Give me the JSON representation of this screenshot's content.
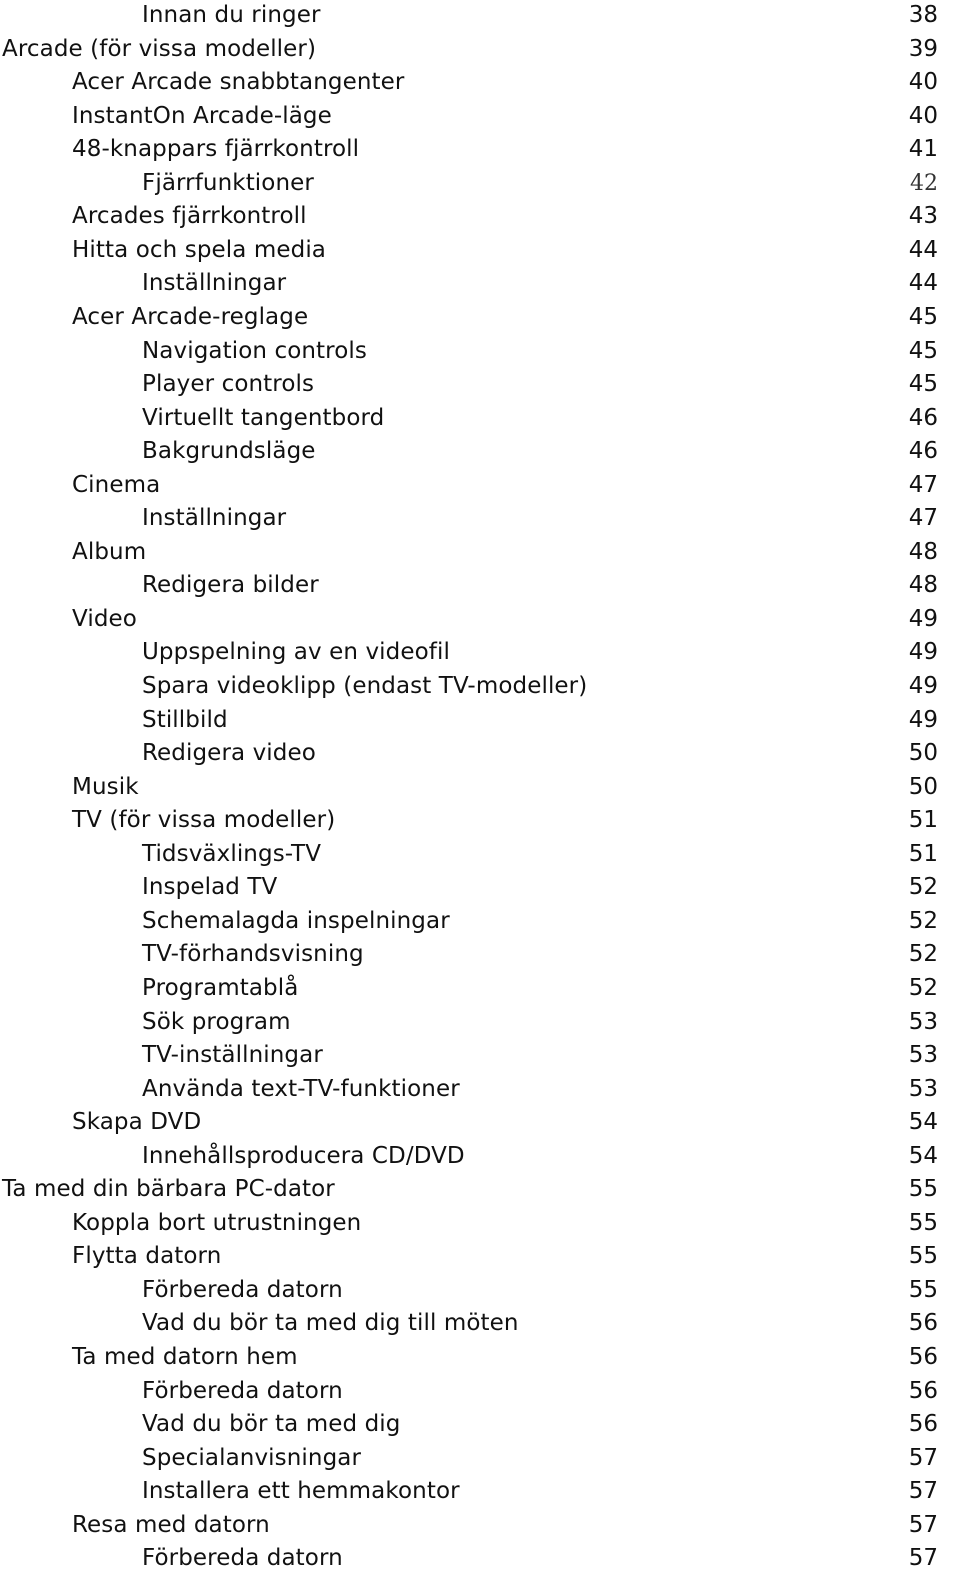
{
  "document": {
    "section": "table-of-contents",
    "entries": [
      {
        "title": "Innan du ringer",
        "page": "38",
        "level": 2
      },
      {
        "title": "Arcade (för vissa modeller)",
        "page": "39",
        "level": 0
      },
      {
        "title": "Acer Arcade snabbtangenter",
        "page": "40",
        "level": 1
      },
      {
        "title": "InstantOn Arcade-läge",
        "page": "40",
        "level": 1
      },
      {
        "title": "48-knappars fjärrkontroll",
        "page": "41",
        "level": 1
      },
      {
        "title": "Fjärrfunktioner",
        "page": "42",
        "level": 2,
        "page_style": "serif"
      },
      {
        "title": "Arcades fjärrkontroll",
        "page": "43",
        "level": 1
      },
      {
        "title": "Hitta och spela media",
        "page": "44",
        "level": 1
      },
      {
        "title": "Inställningar",
        "page": "44",
        "level": 2
      },
      {
        "title": "Acer Arcade-reglage",
        "page": "45",
        "level": 1
      },
      {
        "title": "Navigation controls",
        "page": "45",
        "level": 2
      },
      {
        "title": "Player controls",
        "page": "45",
        "level": 2
      },
      {
        "title": "Virtuellt tangentbord",
        "page": "46",
        "level": 2
      },
      {
        "title": "Bakgrundsläge",
        "page": "46",
        "level": 2
      },
      {
        "title": "Cinema",
        "page": "47",
        "level": 1
      },
      {
        "title": "Inställningar",
        "page": "47",
        "level": 2
      },
      {
        "title": "Album",
        "page": "48",
        "level": 1
      },
      {
        "title": "Redigera bilder",
        "page": "48",
        "level": 2
      },
      {
        "title": "Video",
        "page": "49",
        "level": 1
      },
      {
        "title": "Uppspelning av en videofil",
        "page": "49",
        "level": 2
      },
      {
        "title": "Spara videoklipp (endast TV-modeller)",
        "page": "49",
        "level": 2
      },
      {
        "title": "Stillbild",
        "page": "49",
        "level": 2
      },
      {
        "title": "Redigera video",
        "page": "50",
        "level": 2
      },
      {
        "title": "Musik",
        "page": "50",
        "level": 1
      },
      {
        "title": "TV (för vissa modeller)",
        "page": "51",
        "level": 1
      },
      {
        "title": "Tidsväxlings-TV",
        "page": "51",
        "level": 2
      },
      {
        "title": "Inspelad TV",
        "page": "52",
        "level": 2
      },
      {
        "title": "Schemalagda inspelningar",
        "page": "52",
        "level": 2
      },
      {
        "title": "TV-förhandsvisning",
        "page": "52",
        "level": 2
      },
      {
        "title": "Programtablå",
        "page": "52",
        "level": 2
      },
      {
        "title": "Sök program",
        "page": "53",
        "level": 2
      },
      {
        "title": "TV-inställningar",
        "page": "53",
        "level": 2
      },
      {
        "title": "Använda text-TV-funktioner",
        "page": "53",
        "level": 2
      },
      {
        "title": "Skapa DVD",
        "page": "54",
        "level": 1
      },
      {
        "title": "Innehållsproducera CD/DVD",
        "page": "54",
        "level": 2
      },
      {
        "title": "Ta med din bärbara PC-dator",
        "page": "55",
        "level": 0
      },
      {
        "title": "Koppla bort utrustningen",
        "page": "55",
        "level": 1
      },
      {
        "title": "Flytta datorn",
        "page": "55",
        "level": 1
      },
      {
        "title": "Förbereda datorn",
        "page": "55",
        "level": 2
      },
      {
        "title": "Vad du bör ta med dig till möten",
        "page": "56",
        "level": 2
      },
      {
        "title": "Ta med datorn hem",
        "page": "56",
        "level": 1
      },
      {
        "title": "Förbereda datorn",
        "page": "56",
        "level": 2
      },
      {
        "title": "Vad du bör ta med dig",
        "page": "56",
        "level": 2
      },
      {
        "title": "Specialanvisningar",
        "page": "57",
        "level": 2
      },
      {
        "title": "Installera ett hemmakontor",
        "page": "57",
        "level": 2
      },
      {
        "title": "Resa med datorn",
        "page": "57",
        "level": 1
      },
      {
        "title": "Förbereda datorn",
        "page": "57",
        "level": 2
      }
    ]
  }
}
